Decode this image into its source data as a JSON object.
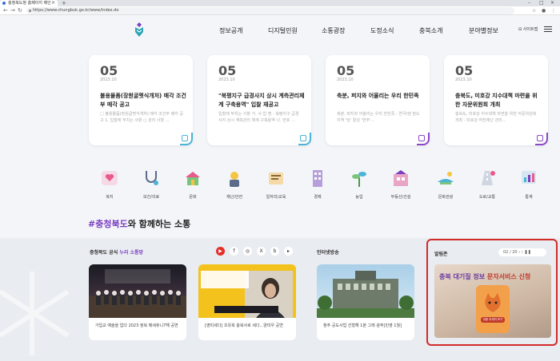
{
  "browser": {
    "tab_title": "충청북도청 홈페이지 메인",
    "url": "https://www.chungbuk.go.kr/www/index.do"
  },
  "header": {
    "nav": [
      "정보공개",
      "디지털민원",
      "소통광장",
      "도정소식",
      "충북소개",
      "분야별정보"
    ],
    "sitemap_label": "사이트맵"
  },
  "cards": [
    {
      "day": "05",
      "ym": "2023.10",
      "title": "불용물품(장원굴쩟식개처) 매각 조건부 매각 공고",
      "desc": "□ 불용물품(장원굴쩟식개처) 매각 조건부 매각 공고 1. 입찰에 부치는 사항 ○ 관리 사항 ..."
    },
    {
      "day": "05",
      "ym": "2023.10",
      "title": "\"북평지구 급경사지 상시 계측관리체계 구축용역\" 입찰 재공고",
      "desc": "입찰에 부치는 사항 가. 사 업 명 : 북평지구 급경사지 상시 계측관리 체계 구축용역 나. 번호 ..."
    },
    {
      "day": "05",
      "ym": "2023.10",
      "title": "축분, 퍼지와 어울리는 우리 한민족",
      "desc": "축분, 퍼지와 어울리는 우리 한민족 - 연극/렌 정도 지역 '당' 활성 '연주'..."
    },
    {
      "day": "05",
      "ym": "2023.10",
      "title": "충북도, 미호강 지수대책 마련을 위한 자문위원회 개최",
      "desc": "충북도, 미호강 지수대책 마련을 위한 자문위원회 개최 - 미호강 하천재난 관리..."
    }
  ],
  "categories": [
    "복지",
    "보건/의료",
    "문화",
    "재난/안전",
    "일자리/교육",
    "경제",
    "농업",
    "부동산/건설",
    "문화관광",
    "도로/교통",
    "통계"
  ],
  "hashtag": {
    "tag": "#충청북도",
    "rest": "와 함께하는 소통"
  },
  "sns": {
    "title_prefix": "충청북도 공식",
    "title_highlight": "누리 소통망",
    "buttons": [
      "▶",
      "f",
      "◎",
      "X",
      "b",
      "▸"
    ]
  },
  "videos": [
    {
      "caption": "가입교 예술을 입다 2023 정북 메세쥬니7해 공연"
    },
    {
      "caption": "[영미세다] 조유희 충북사로 세다...양미우 공연"
    }
  ],
  "internet_tv": {
    "title": "인터넷방송",
    "caption": "청주 공도사업 선형해 1분 그래 광주[민영 1월]"
  },
  "alarm": {
    "title": "알림존",
    "pager": "02 / 20",
    "banner_head_1": "충북 대기질 정보",
    "banner_head_2": "문자서비스 신청",
    "banner_button": "내용 자세히 보기"
  }
}
